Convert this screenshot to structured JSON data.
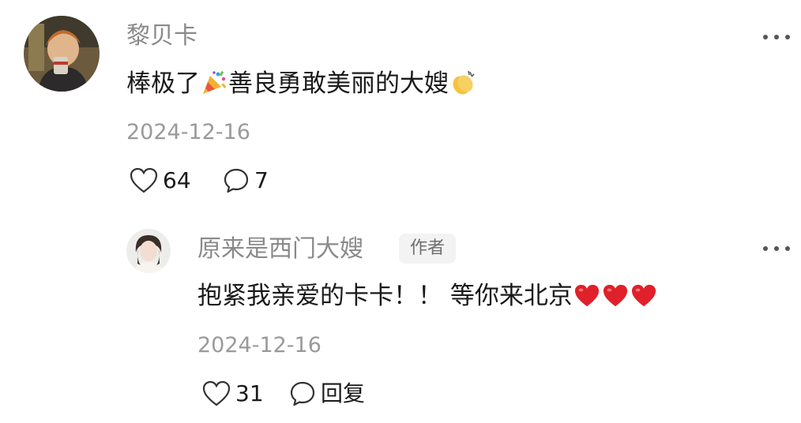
{
  "comments": [
    {
      "username": "黎贝卡",
      "text_before": "棒极了",
      "text_middle": "善良勇敢美丽的大嫂",
      "date": "2024-12-16",
      "likes": "64",
      "replies": "7",
      "emoji": [
        "party-popper",
        "clapping-hands"
      ]
    }
  ],
  "reply": {
    "username": "原来是西门大嫂",
    "badge": "作者",
    "text": "抱紧我亲爱的卡卡！！ 等你来北京",
    "emoji": [
      "red-heart",
      "red-heart",
      "red-heart"
    ],
    "date": "2024-12-16",
    "likes": "31",
    "reply_label": "回复"
  },
  "colors": {
    "username": "#8a8a8a",
    "text": "#1a1a1a",
    "date": "#9a9a9a",
    "heart": "#e0202a"
  }
}
